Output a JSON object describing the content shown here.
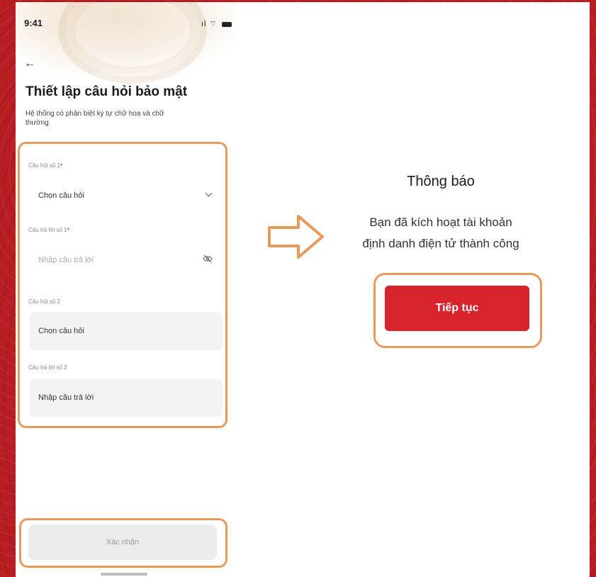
{
  "status_bar": {
    "time": "9:41",
    "signal_icons": "ıl ⌔"
  },
  "security_form": {
    "title": "Thiết lập câu hỏi bảo mật",
    "subtitle": "Hệ thống có phân biệt ký tự chữ hoa và chữ thường",
    "question_1_label": "Câu hỏi số 1",
    "question_1_value": "Chọn câu hỏi",
    "answer_1_label": "Câu trả lời số 1",
    "answer_1_placeholder": "Nhập câu trả lời",
    "question_2_label": "Câu hỏi số 2",
    "question_2_value": "Chọn câu hỏi",
    "answer_2_label": "Câu trả lời số 2",
    "answer_2_value": "Nhập câu trả lời",
    "required_mark": "*",
    "confirm_label": "Xác nhận"
  },
  "notice": {
    "title": "Thông báo",
    "message_line_1": "Bạn đã kích hoạt tài khoản",
    "message_line_2": "định danh điện tử thành công",
    "continue_label": "Tiếp tục"
  },
  "colors": {
    "brand_red": "#d9232c",
    "highlight_orange": "#e89a5e",
    "background_red": "#b81d22"
  },
  "icons": [
    "back-arrow-icon",
    "chevron-down-icon",
    "eye-off-icon",
    "right-arrow-icon",
    "battery-icon",
    "signal-icon"
  ]
}
